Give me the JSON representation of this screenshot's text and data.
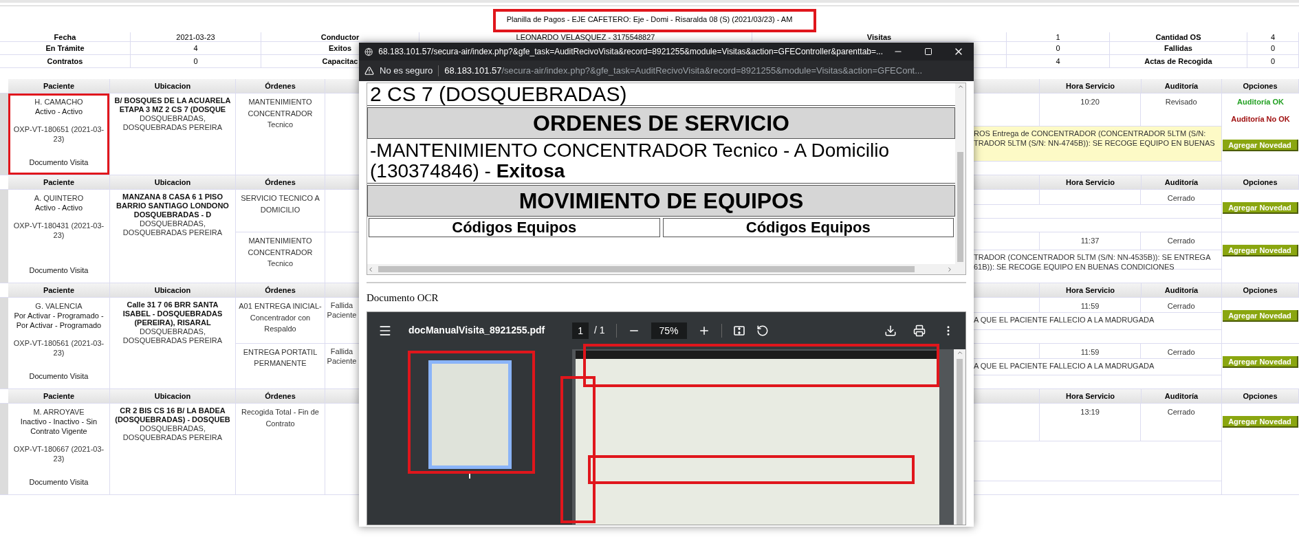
{
  "title": {
    "text": "Planilla de Pagos - EJE CAFETERO: Eje - Domi - Risaralda 08 (S) (2021/03/23) - AM",
    "highlighted": true
  },
  "summary": [
    {
      "left": [
        {
          "text": "Fecha",
          "kind": "label"
        },
        {
          "text": "2021-03-23",
          "kind": "value"
        },
        {
          "text": "Conductor",
          "kind": "label"
        }
      ],
      "middle": [
        {
          "text": "LEONARDO VELASQUEZ - 3175548827",
          "kind": "value"
        },
        {
          "text": "Visitas",
          "kind": "label"
        }
      ],
      "right": [
        {
          "text": "1",
          "kind": "value"
        },
        {
          "text": "Cantidad OS",
          "kind": "label"
        },
        {
          "text": "4",
          "kind": "value"
        }
      ]
    },
    {
      "left": [
        {
          "text": "En Trámite",
          "kind": "label"
        },
        {
          "text": "4",
          "kind": "value"
        },
        {
          "text": "Exitos",
          "kind": "label"
        }
      ],
      "right": [
        {
          "text": "0",
          "kind": "value"
        },
        {
          "text": "Fallidas",
          "kind": "label"
        },
        {
          "text": "0",
          "kind": "value"
        }
      ]
    },
    {
      "left": [
        {
          "text": "Contratos",
          "kind": "label"
        },
        {
          "text": "0",
          "kind": "value"
        },
        {
          "text": "Capacitac",
          "kind": "label"
        }
      ],
      "right": [
        {
          "text": "4",
          "kind": "value"
        },
        {
          "text": "Actas de Recogida",
          "kind": "label"
        },
        {
          "text": "0",
          "kind": "value"
        }
      ]
    }
  ],
  "visits": [
    {
      "header": [
        "Paciente",
        "Ubicacion",
        "Órdenes",
        "Hora Servicio",
        "Auditoría",
        "Opciones"
      ],
      "patient": {
        "name": "H. CAMACHO",
        "status": "Activo - Activo",
        "code": "OXP-VT-180651 (2021-03-23)",
        "document": "Documento Visita",
        "highlighted": true
      },
      "address": "B/ BOSQUES DE LA ACUARELA ETAPA 3 MZ 2 CS 7 (DOSQUE",
      "city": "DOSQUEBRADAS, DOSQUEBRADAS PEREIRA",
      "orders": [
        {
          "order": "MANTENIMIENTO CONCENTRADOR Tecnico",
          "time": "10:20",
          "audit": "Revisado",
          "note_lines": [
            "ROS Entrega de CONCENTRADOR (CONCENTRADOR 5LTM (S/N:",
            "TRADOR 5LTM (S/N: NN-4745B)): SE RECOGE EQUIPO EN BUENAS"
          ],
          "note_highlighted": true,
          "links": [
            {
              "label": "Auditoría OK",
              "kind": "ok"
            },
            {
              "label": "Auditoría No OK",
              "kind": "not_ok"
            }
          ],
          "button": "Agregar Novedad"
        }
      ]
    },
    {
      "header": [
        "Paciente",
        "Ubicacion",
        "Órdenes",
        "Hora Servicio",
        "Auditoría",
        "Opciones"
      ],
      "patient": {
        "name": "A. QUINTERO",
        "status": "Activo - Activo",
        "code": "OXP-VT-180431 (2021-03-23)",
        "document": "Documento Visita",
        "highlighted": false
      },
      "address": "MANZANA 8 CASA 6 1 PISO BARRIO SANTIAGO LONDONO DOSQUEBRADAS - D",
      "city": "DOSQUEBRADAS, DOSQUEBRADAS PEREIRA",
      "orders": [
        {
          "order": "SERVICIO TECNICO A DOMICILIO",
          "audit": "Cerrado",
          "note_highlighted": false,
          "button": "Agregar Novedad"
        },
        {
          "order": "MANTENIMIENTO CONCENTRADOR Tecnico",
          "time": "11:37",
          "audit": "Cerrado",
          "note_lines": [
            "TRADOR (CONCENTRADOR 5LTM (S/N: NN-4535B)): SE ENTREGA",
            "61B)): SE RECOGE EQUIPO EN BUENAS CONDICIONES"
          ],
          "note_highlighted": false,
          "button": "Agregar Novedad"
        }
      ]
    },
    {
      "header": [
        "Paciente",
        "Ubicacion",
        "Órdenes",
        "Hora Servicio",
        "Auditoría",
        "Opciones"
      ],
      "patient": {
        "name": "G. VALENCIA",
        "status": "Por Activar - Programado - Por Activar - Programado",
        "code": "OXP-VT-180561 (2021-03-23)",
        "document": "Documento Visita",
        "highlighted": false
      },
      "address": "Calle 31 7 06 BRR SANTA ISABEL - DOSQUEBRADAS (PEREIRA), RISARAL",
      "city": "DOSQUEBRADAS, DOSQUEBRADAS PEREIRA",
      "orders": [
        {
          "order": "A01 ENTREGA INICIAL- Concentrador con Respaldo",
          "result": "Fallida Paciente",
          "time": "11:59",
          "audit": "Cerrado",
          "note_lines": [
            "A QUE EL PACIENTE FALLECIO A LA MADRUGADA"
          ],
          "note_highlighted": false,
          "button": "Agregar Novedad"
        },
        {
          "order": "ENTREGA PORTATIL PERMANENTE",
          "result": "Fallida Paciente",
          "time": "11:59",
          "audit": "Cerrado",
          "note_lines": [
            "A QUE EL PACIENTE FALLECIO A LA MADRUGADA"
          ],
          "note_highlighted": false,
          "button": "Agregar Novedad"
        }
      ]
    },
    {
      "header": [
        "Paciente",
        "Ubicacion",
        "Órdenes",
        "Hora Servicio",
        "Auditoría",
        "Opciones"
      ],
      "patient": {
        "name": "M. ARROYAVE",
        "status": "Inactivo - Inactivo - Sin Contrato Vigente",
        "code": "OXP-VT-180667 (2021-03-23)",
        "document": "Documento Visita",
        "highlighted": false
      },
      "address": "CR 2 BIS CS 16 B/ LA BADEA (DOSQUEBRADAS) - DOSQUEB",
      "city": "DOSQUEBRADAS, DOSQUEBRADAS PEREIRA",
      "orders": [
        {
          "order": "Recogida Total - Fin de Contrato",
          "time": "13:19",
          "audit": "Cerrado",
          "note_highlighted": false,
          "button": "Agregar Novedad"
        }
      ]
    }
  ],
  "popup": {
    "title": "68.183.101.57/secura-air/index.php?&gfe_task=AuditRecivoVisita&record=8921255&module=Visitas&action=GFEController&parenttab=...",
    "security": "No es seguro",
    "host": "68.183.101.57",
    "path": "/secura-air/index.php?&gfe_task=AuditRecivoVisita&record=8921255&module=Visitas&action=GFECont...",
    "document": {
      "address_line": "2 CS 7 (DOSQUEBRADAS)",
      "orders_heading": "ORDENES DE SERVICIO",
      "order_line": "-MANTENIMIENTO CONCENTRADOR Tecnico - A Domicilio (130374846) - **Exitosa**",
      "equipment_heading": "MOVIMIENTO DE EQUIPOS",
      "equipment_columns": [
        "Códigos Equipos",
        "Códigos Equipos"
      ]
    },
    "ocr_label": "Documento OCR",
    "pdf": {
      "filename": "docManualVisita_8921255.pdf",
      "page": "1",
      "pages": "/ 1",
      "zoom": "75%",
      "thumbnail_highlighted": true,
      "thumbnail_selected": true
    }
  }
}
